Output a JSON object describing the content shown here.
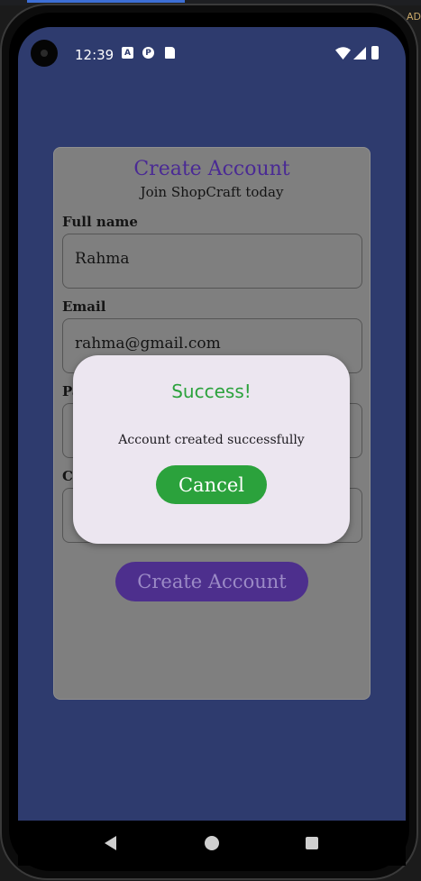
{
  "host": {
    "corner_text": "AD"
  },
  "status_bar": {
    "time": "12:39",
    "icons": [
      "a-notification-icon",
      "p-notification-icon",
      "sd-card-icon",
      "wifi-icon",
      "signal-icon",
      "battery-icon"
    ],
    "icon_glyphs": {
      "a": "A",
      "p": "P"
    }
  },
  "form": {
    "title": "Create Account",
    "subtitle": "Join ShopCraft today",
    "fields": [
      {
        "label": "Full name",
        "value": "Rahma"
      },
      {
        "label": "Email",
        "value": "rahma@gmail.com"
      },
      {
        "label": "Pa",
        "value": ""
      },
      {
        "label": "Co",
        "value": ""
      }
    ],
    "submit_label": "Create Account"
  },
  "dialog": {
    "title": "Success!",
    "message": "Account created successfully",
    "cancel_label": "Cancel"
  },
  "nav": {
    "icons": [
      "back-icon",
      "home-icon",
      "recents-icon"
    ]
  },
  "colors": {
    "background": "#2e3b6e",
    "accent_purple": "#4d2f8d",
    "title_purple": "#4a2a94",
    "success_green": "#2ba23c",
    "dialog_bg": "#ece6f0"
  }
}
